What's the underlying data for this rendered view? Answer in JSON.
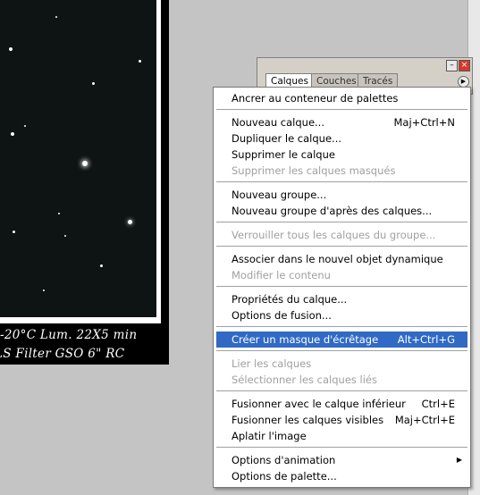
{
  "canvas": {
    "caption_line1": "-20°C Lum. 22X5 min",
    "caption_line2": "LS Filter GSO 6\" RC"
  },
  "palette": {
    "tabs": [
      "Calques",
      "Couches",
      "Tracés"
    ],
    "menu_icon": "palette-menu-icon",
    "minimize_icon": "minimize-icon",
    "close_icon": "close-icon"
  },
  "menu": {
    "items": [
      {
        "label": "Ancrer au conteneur de palettes",
        "shortcut": "",
        "disabled": false
      },
      {
        "label": "Nouveau calque...",
        "shortcut": "Maj+Ctrl+N",
        "disabled": false
      },
      {
        "label": "Dupliquer le calque...",
        "shortcut": "",
        "disabled": false
      },
      {
        "label": "Supprimer le calque",
        "shortcut": "",
        "disabled": false
      },
      {
        "label": "Supprimer les calques masqués",
        "shortcut": "",
        "disabled": true
      },
      {
        "label": "Nouveau groupe...",
        "shortcut": "",
        "disabled": false
      },
      {
        "label": "Nouveau groupe d'après des calques...",
        "shortcut": "",
        "disabled": false
      },
      {
        "label": "Verrouiller tous les calques du groupe...",
        "shortcut": "",
        "disabled": true
      },
      {
        "label": "Associer dans le nouvel objet dynamique",
        "shortcut": "",
        "disabled": false
      },
      {
        "label": "Modifier le contenu",
        "shortcut": "",
        "disabled": true
      },
      {
        "label": "Propriétés du calque...",
        "shortcut": "",
        "disabled": false
      },
      {
        "label": "Options de fusion...",
        "shortcut": "",
        "disabled": false
      },
      {
        "label": "Créer un masque d'écrêtage",
        "shortcut": "Alt+Ctrl+G",
        "disabled": false,
        "selected": true
      },
      {
        "label": "Lier les calques",
        "shortcut": "",
        "disabled": true
      },
      {
        "label": "Sélectionner les calques liés",
        "shortcut": "",
        "disabled": true
      },
      {
        "label": "Fusionner avec le calque inférieur",
        "shortcut": "Ctrl+E",
        "disabled": false
      },
      {
        "label": "Fusionner les calques visibles",
        "shortcut": "Maj+Ctrl+E",
        "disabled": false
      },
      {
        "label": "Aplatir l'image",
        "shortcut": "",
        "disabled": false
      },
      {
        "label": "Options d'animation",
        "shortcut": "",
        "disabled": false,
        "submenu": true
      },
      {
        "label": "Options de palette...",
        "shortcut": "",
        "disabled": false
      }
    ],
    "selected_color": "#316ac5"
  }
}
